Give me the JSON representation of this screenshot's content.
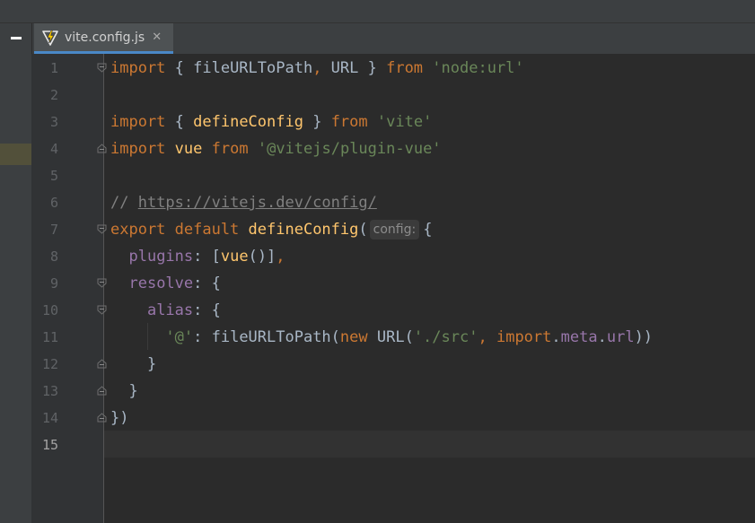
{
  "tabs": [
    {
      "label": "vite.config.js",
      "icon": "vite-icon",
      "active": true
    }
  ],
  "editor": {
    "current_line": 15,
    "line_numbers": [
      "1",
      "2",
      "3",
      "4",
      "5",
      "6",
      "7",
      "8",
      "9",
      "10",
      "11",
      "12",
      "13",
      "14",
      "15"
    ],
    "lines": {
      "l1": {
        "kw1": "import",
        "p1": " { fileURLToPath",
        "kw2": ",",
        "p2": " URL } ",
        "kw3": "from",
        "p3": " ",
        "s1": "'node:url'"
      },
      "l3": {
        "kw1": "import",
        "p1": " { ",
        "f1": "defineConfig",
        "p2": " } ",
        "kw2": "from",
        "p3": " ",
        "s1": "'vite'"
      },
      "l4": {
        "kw1": "import",
        "p1": " ",
        "f1": "vue",
        "p2": " ",
        "kw2": "from",
        "p3": " ",
        "s1": "'@vitejs/plugin-vue'"
      },
      "l6": {
        "c1": "// ",
        "link": "https://vitejs.dev/config/"
      },
      "l7": {
        "kw1": "export default",
        "p1": " ",
        "f1": "defineConfig",
        "p2": "(",
        "hint": "config:",
        "p3": "{"
      },
      "l8": {
        "pad": "  ",
        "pr1": "plugins",
        "p1": ": [",
        "f1": "vue",
        "p2": "()]",
        "kw1": ","
      },
      "l9": {
        "pad": "  ",
        "pr1": "resolve",
        "p1": ": {"
      },
      "l10": {
        "pad": "    ",
        "pr1": "alias",
        "p1": ": {"
      },
      "l11": {
        "pad": "      ",
        "s1": "'@'",
        "p1": ": fileURLToPath(",
        "kw1": "new",
        "p2": " URL(",
        "s2": "'./src'",
        "kw2": ",",
        "p3": " ",
        "kw3": "import",
        "p4": ".",
        "pr1": "meta",
        "p5": ".",
        "pr2": "url",
        "p6": "))"
      },
      "l12": {
        "pad": "    ",
        "p1": "}"
      },
      "l13": {
        "pad": "  ",
        "p1": "}"
      },
      "l14": {
        "p1": "})"
      }
    }
  },
  "colors": {
    "keyword": "#cc7832",
    "string": "#6a8759",
    "function": "#ffc66d",
    "property": "#9876aa",
    "comment": "#808080",
    "text": "#a9b7c6",
    "background": "#2b2b2b"
  }
}
